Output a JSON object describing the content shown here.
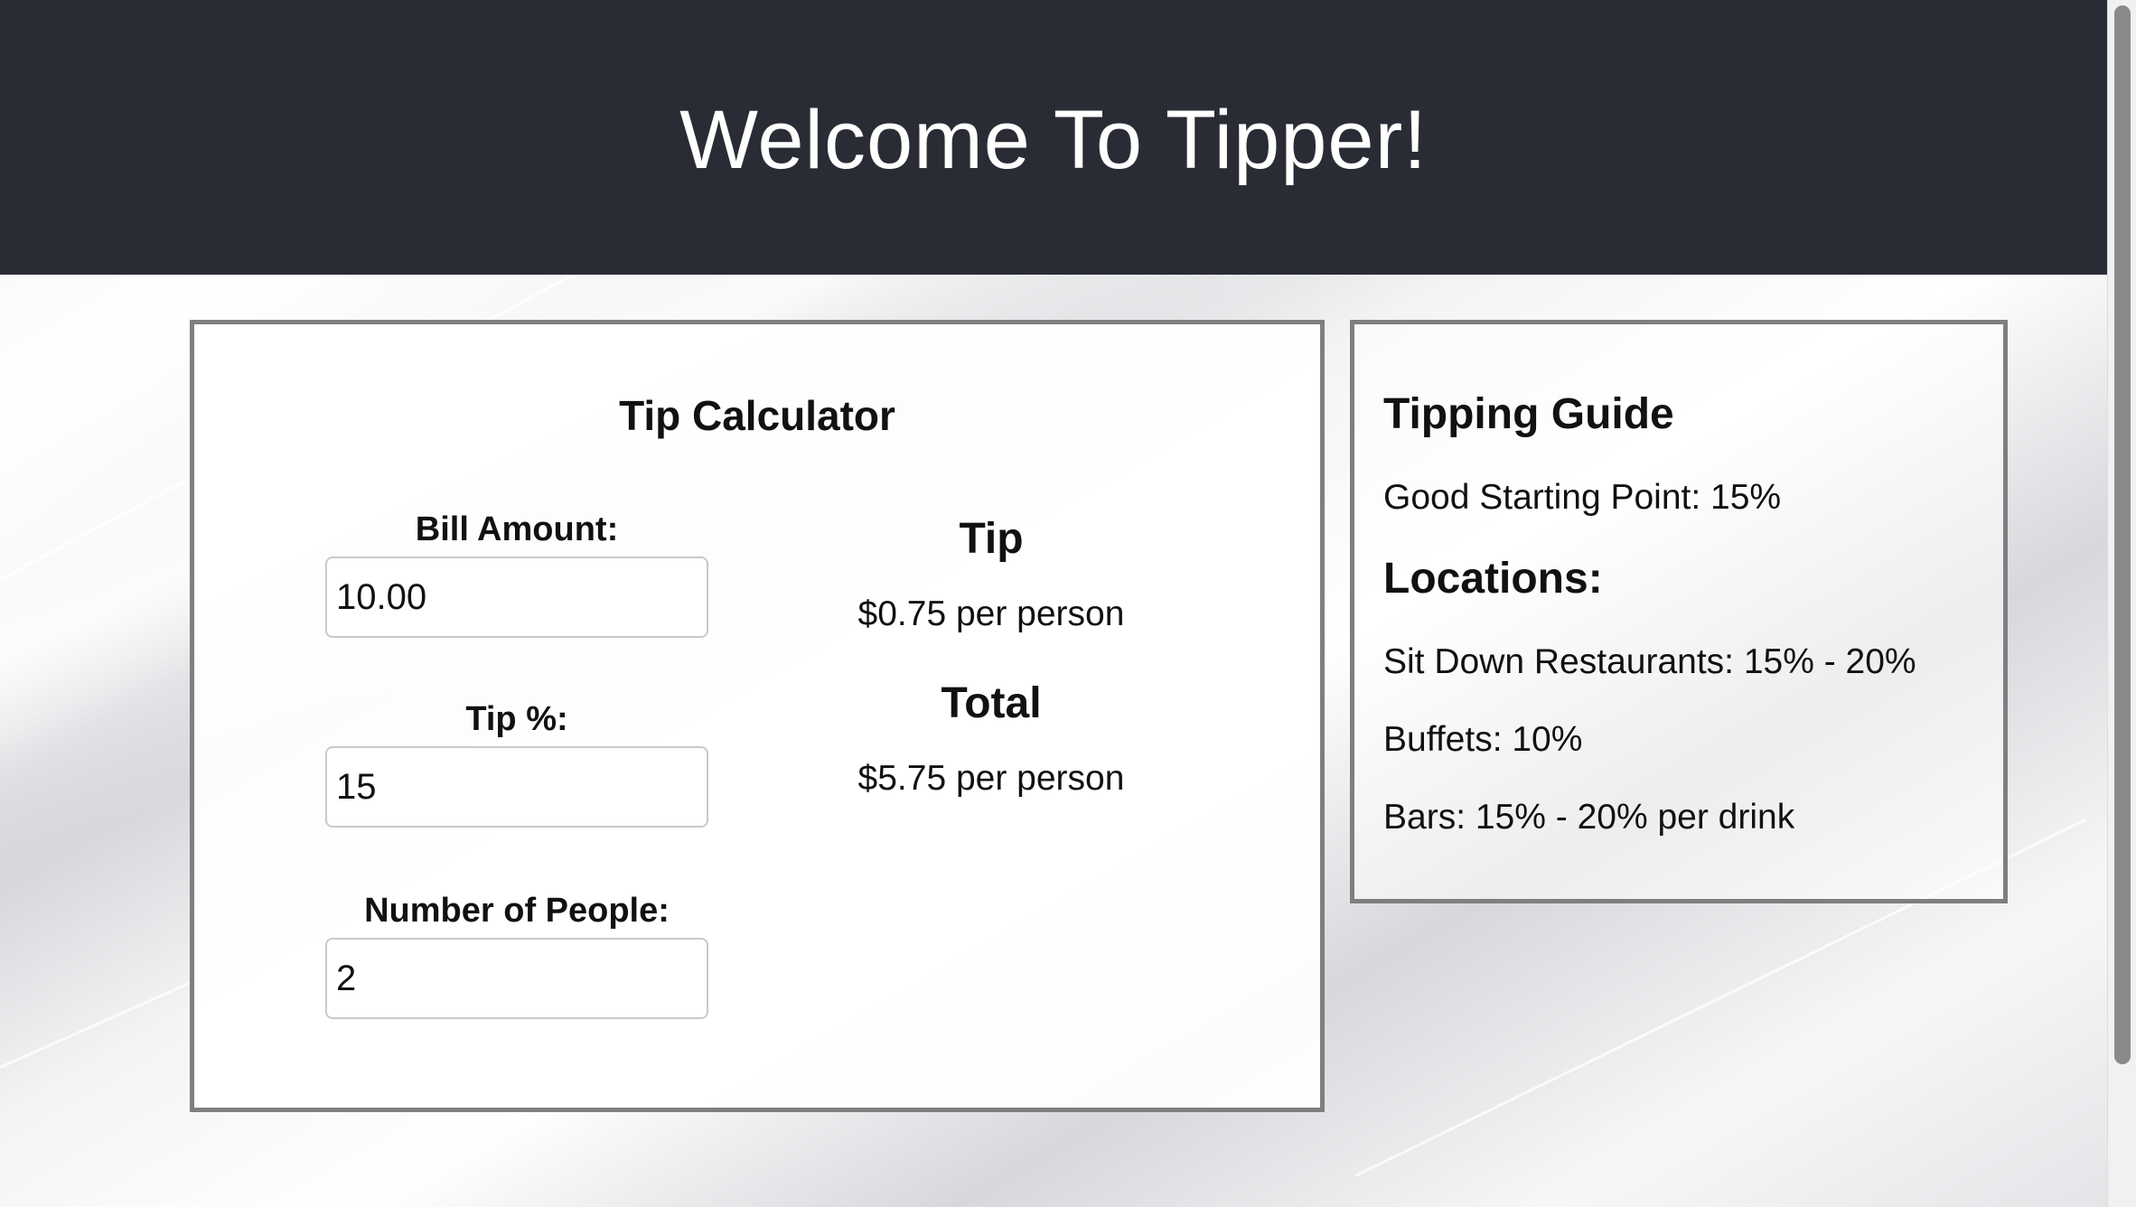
{
  "header": {
    "title": "Welcome To Tipper!"
  },
  "calculator": {
    "title": "Tip Calculator",
    "bill_label": "Bill Amount:",
    "bill_value": "10.00",
    "tip_label": "Tip %:",
    "tip_value": "15",
    "people_label": "Number of People:",
    "people_value": "2",
    "tip_heading": "Tip",
    "tip_result": "$0.75 per person",
    "total_heading": "Total",
    "total_result": "$5.75 per person"
  },
  "guide": {
    "title": "Tipping Guide",
    "starting_point": "Good Starting Point: 15%",
    "locations_title": "Locations:",
    "locations": [
      "Sit Down Restaurants: 15% - 20%",
      "Buffets: 10%",
      "Bars: 15% - 20% per drink"
    ]
  },
  "colors": {
    "header_bg": "#2a2c35",
    "panel_border": "#7f7f7f"
  }
}
